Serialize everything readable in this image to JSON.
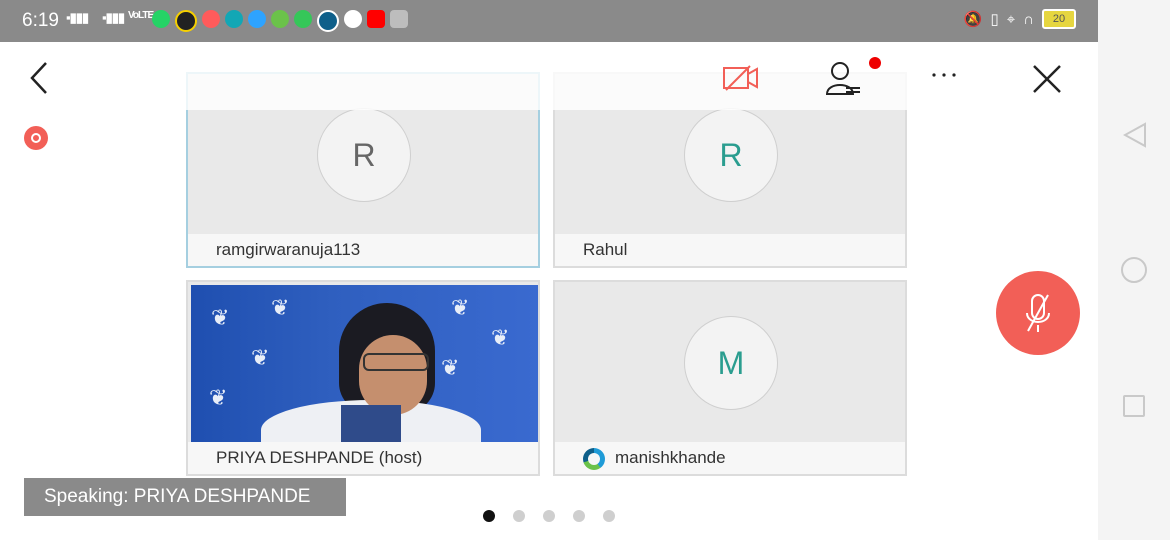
{
  "status_bar": {
    "time": "6:19",
    "signal1": "4G",
    "signal2": "VoLTE",
    "battery": "20"
  },
  "colors": {
    "accent": "#f25f57",
    "tile_active_border": "#a5cfe0",
    "overlay": "#8a8a8a"
  },
  "participants": [
    {
      "initial": "R",
      "name": "ramgirwaranuja113",
      "initial_color": "#666666"
    },
    {
      "initial": "R",
      "name": "Rahul",
      "initial_color": "#2a9d8f"
    },
    {
      "initial": "",
      "name": "PRIYA DESHPANDE (host)",
      "initial_color": ""
    },
    {
      "initial": "M",
      "name": "manishkhande",
      "initial_color": "#2a9d8f"
    }
  ],
  "speaking": "Speaking: PRIYA DESHPANDE",
  "pager": {
    "pages": 5,
    "current": 1
  }
}
